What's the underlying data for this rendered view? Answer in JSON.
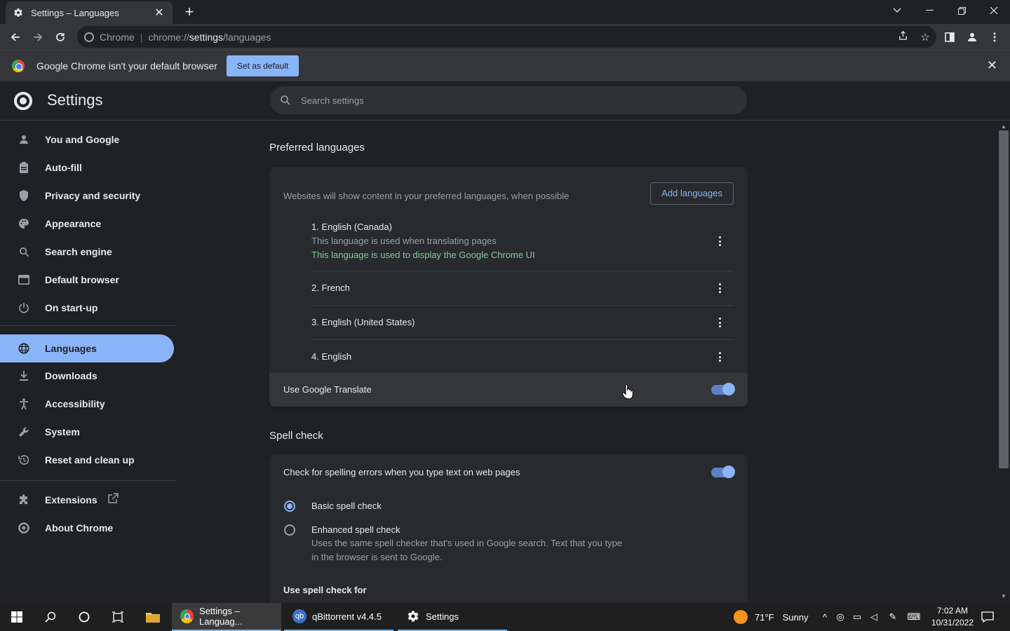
{
  "browser": {
    "tab_title": "Settings – Languages",
    "tab_close": "✕",
    "new_tab": "+",
    "omnibox": {
      "site_label": "Chrome",
      "url_prefix": "chrome://",
      "url_host": "settings",
      "url_path": "/languages"
    }
  },
  "infobar": {
    "message": "Google Chrome isn't your default browser",
    "button_label": "Set as default",
    "close": "✕"
  },
  "settings": {
    "title": "Settings",
    "search_placeholder": "Search settings"
  },
  "sidebar": {
    "items": [
      {
        "label": "You and Google",
        "icon": "person-icon"
      },
      {
        "label": "Auto-fill",
        "icon": "clipboard-icon"
      },
      {
        "label": "Privacy and security",
        "icon": "shield-icon"
      },
      {
        "label": "Appearance",
        "icon": "palette-icon"
      },
      {
        "label": "Search engine",
        "icon": "search-icon"
      },
      {
        "label": "Default browser",
        "icon": "browser-icon"
      },
      {
        "label": "On start-up",
        "icon": "power-icon"
      },
      {
        "label": "Languages",
        "icon": "globe-icon"
      },
      {
        "label": "Downloads",
        "icon": "download-icon"
      },
      {
        "label": "Accessibility",
        "icon": "accessibility-icon"
      },
      {
        "label": "System",
        "icon": "wrench-icon"
      },
      {
        "label": "Reset and clean up",
        "icon": "history-icon"
      },
      {
        "label": "Extensions",
        "icon": "puzzle-icon"
      },
      {
        "label": "About Chrome",
        "icon": "chrome-icon"
      }
    ],
    "active_item": "Languages"
  },
  "languages": {
    "section_title": "Preferred languages",
    "description": "Websites will show content in your preferred languages, when possible",
    "add_button": "Add languages",
    "list": [
      {
        "name": "1. English (Canada)",
        "sub": "This language is used when translating pages",
        "ui_note": "This language is used to display the Google Chrome UI"
      },
      {
        "name": "2. French"
      },
      {
        "name": "3. English (United States)"
      },
      {
        "name": "4. English"
      }
    ],
    "translate_label": "Use Google Translate",
    "translate_enabled": true
  },
  "spellcheck": {
    "section_title": "Spell check",
    "toggle_label": "Check for spelling errors when you type text on web pages",
    "toggle_enabled": true,
    "basic_label": "Basic spell check",
    "enhanced_label": "Enhanced spell check",
    "enhanced_desc_line1": "Uses the same spell checker that's used in Google search. Text that you type",
    "enhanced_desc_line2": "in the browser is sent to Google.",
    "selected": "Basic spell check",
    "use_for_label": "Use spell check for"
  },
  "taskbar": {
    "apps": [
      {
        "label": "Settings – Languag...",
        "state": "active"
      },
      {
        "label": "qBittorrent v4.4.5",
        "state": "open"
      },
      {
        "label": "Settings",
        "state": "open"
      }
    ],
    "weather": {
      "temp": "71°F",
      "condition": "Sunny"
    },
    "time": "7:02 AM",
    "date": "10/31/2022"
  },
  "colors": {
    "accent": "#8ab4f8",
    "background": "#202124",
    "card": "#292a2d",
    "green_note": "#81c995"
  }
}
